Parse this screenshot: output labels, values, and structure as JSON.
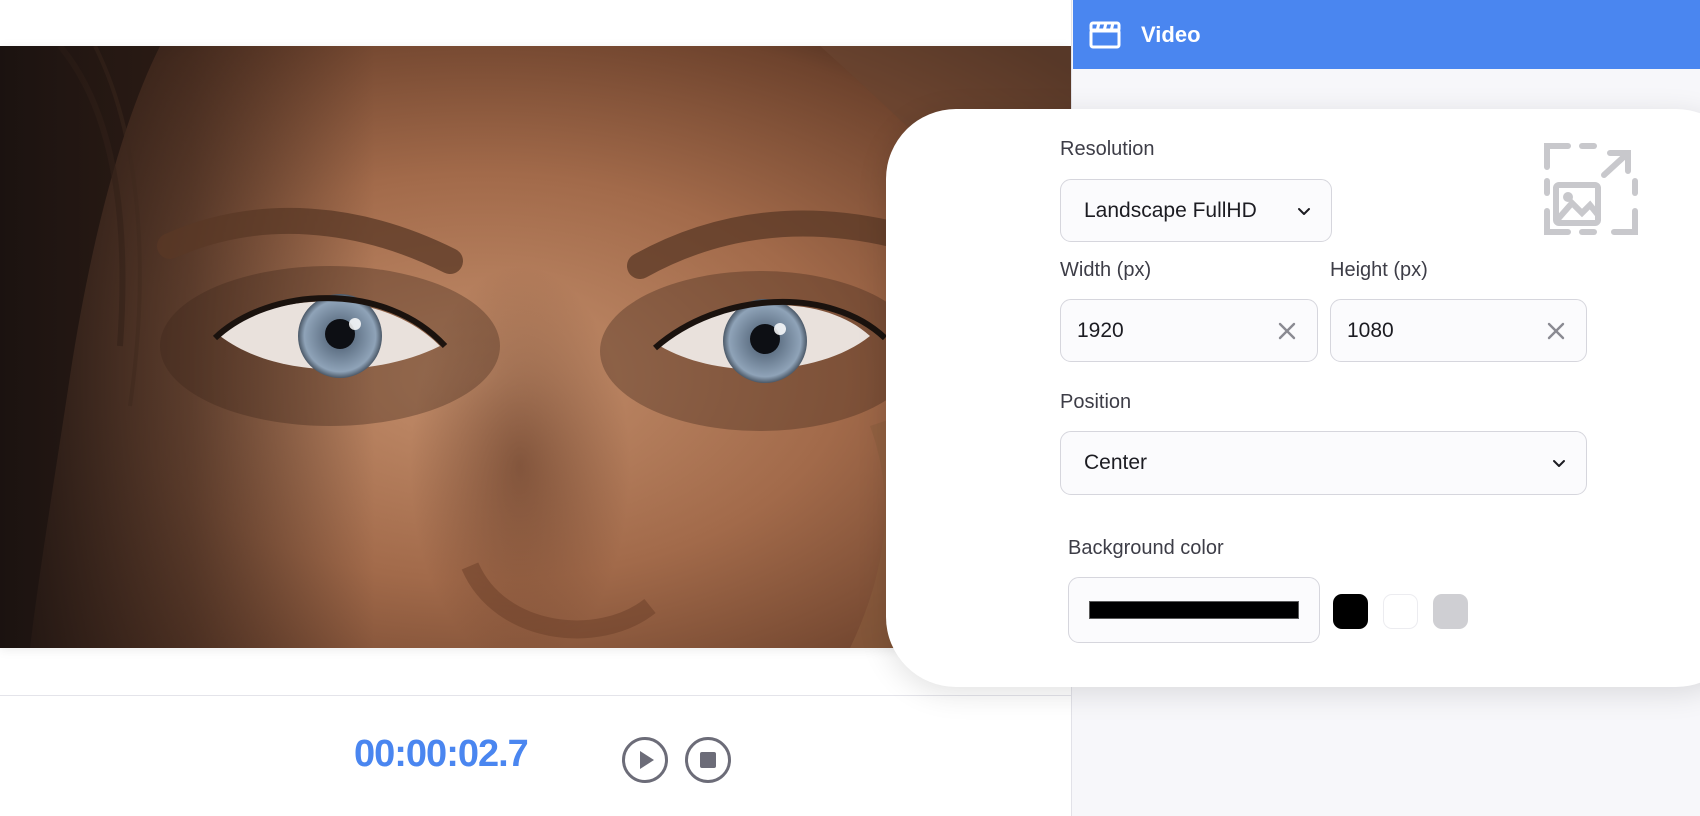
{
  "sidebar": {
    "header": {
      "title": "Video",
      "icon": "clapperboard-icon",
      "color": "#4a86f0"
    }
  },
  "settings": {
    "resolution": {
      "label": "Resolution",
      "value": "Landscape FullHD"
    },
    "width": {
      "label": "Width (px)",
      "value": "1920"
    },
    "height": {
      "label": "Height (px)",
      "value": "1080"
    },
    "position": {
      "label": "Position",
      "value": "Center"
    },
    "background": {
      "label": "Background color",
      "value": "#000000",
      "swatches": [
        {
          "name": "black",
          "color": "#000000"
        },
        {
          "name": "white",
          "color": "#ffffff"
        },
        {
          "name": "gray",
          "color": "#cfcfd3"
        }
      ]
    },
    "resize_icon": "resize-image-icon"
  },
  "player": {
    "timecode": "00:00:02.7",
    "timecode_color": "#4a86f0",
    "play_icon": "play-icon",
    "stop_icon": "stop-icon"
  }
}
